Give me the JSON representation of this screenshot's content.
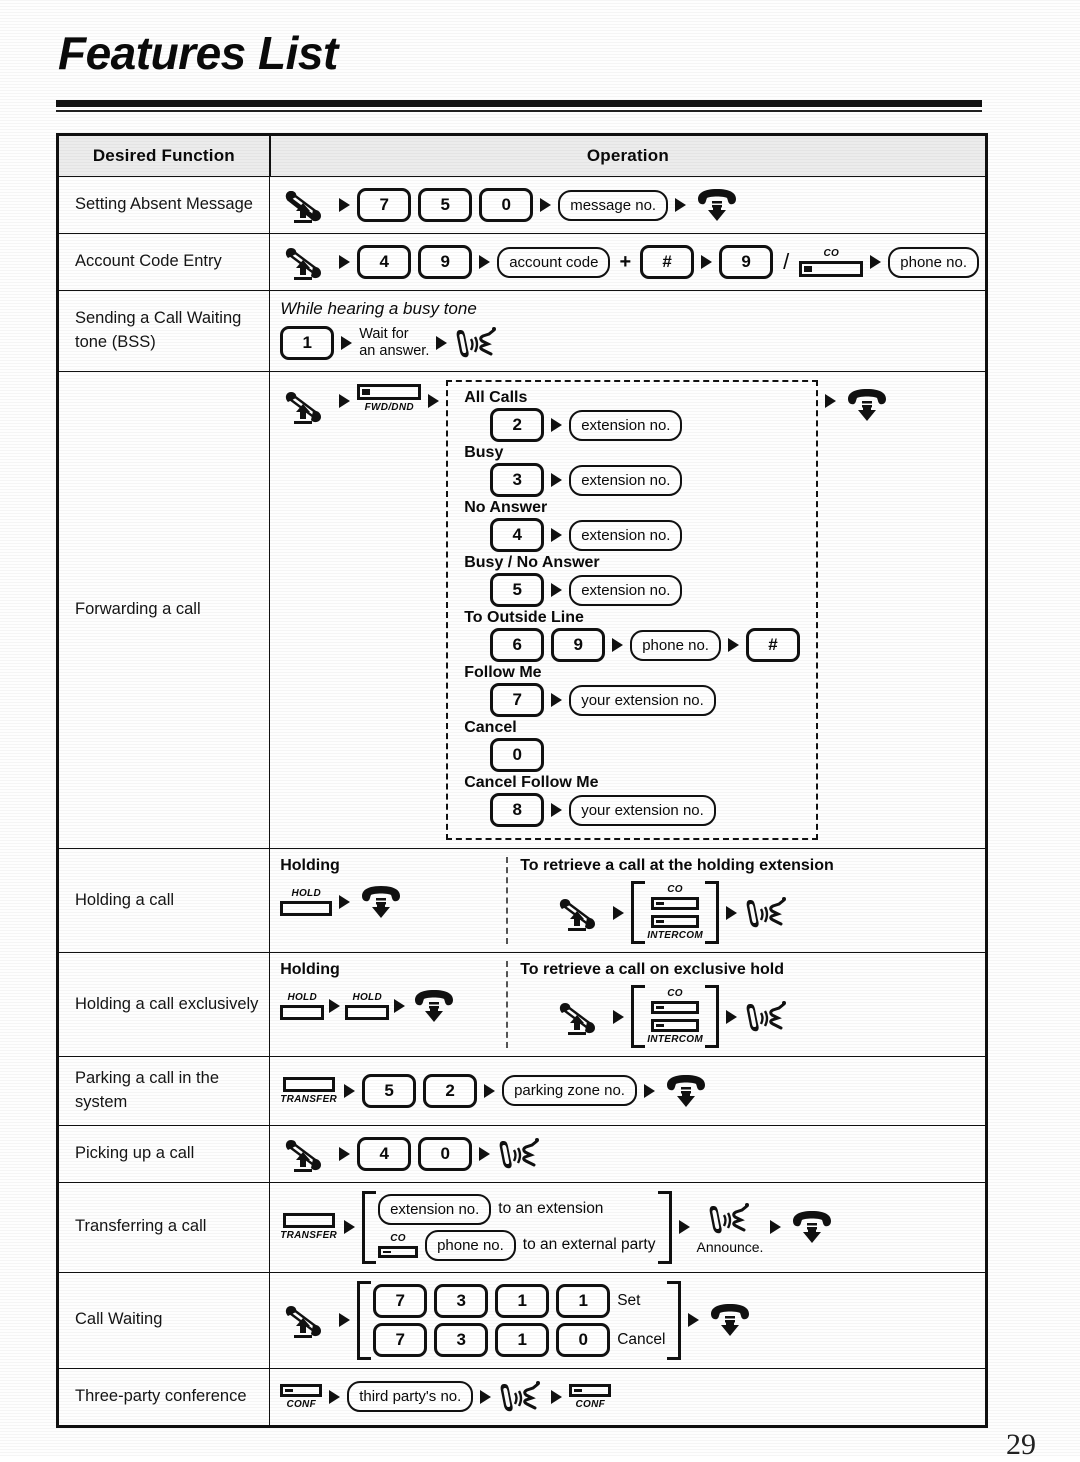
{
  "document": {
    "title": "Features List",
    "page_number": "29"
  },
  "table": {
    "headers": {
      "function": "Desired Function",
      "operation": "Operation"
    },
    "rows": [
      {
        "function": "Setting Absent Message",
        "steps": [
          "offhook-icon",
          "7",
          "5",
          "0",
          "message no.",
          "onhook-icon"
        ],
        "keys": [
          "7",
          "5",
          "0"
        ],
        "field": "message no."
      },
      {
        "function": "Account Code Entry",
        "keys": [
          "4",
          "9"
        ],
        "field_account": "account code",
        "key_hash": "#",
        "key_nine": "9",
        "co_label": "CO",
        "field_phone": "phone no."
      },
      {
        "function": "Sending a Call Waiting tone (BSS)",
        "note": "While hearing a busy tone",
        "key": "1",
        "wait_text_line1": "Wait for",
        "wait_text_line2": "an answer."
      },
      {
        "function": "Forwarding a call",
        "fwd_button_label": "FWD/DND",
        "options": [
          {
            "label": "All Calls",
            "keys": [
              "2"
            ],
            "field": "extension no."
          },
          {
            "label": "Busy",
            "keys": [
              "3"
            ],
            "field": "extension no."
          },
          {
            "label": "No Answer",
            "keys": [
              "4"
            ],
            "field": "extension no."
          },
          {
            "label": "Busy / No Answer",
            "keys": [
              "5"
            ],
            "field": "extension no."
          },
          {
            "label": "To Outside Line",
            "keys": [
              "6",
              "9"
            ],
            "field": "phone no.",
            "trailing_key": "#"
          },
          {
            "label": "Follow Me",
            "keys": [
              "7"
            ],
            "field": "your extension no."
          },
          {
            "label": "Cancel",
            "keys": [
              "0"
            ],
            "field": ""
          },
          {
            "label": "Cancel Follow Me",
            "keys": [
              "8"
            ],
            "field": "your extension no."
          }
        ]
      },
      {
        "function": "Holding a call",
        "left_head": "Holding",
        "hold_label": "HOLD",
        "right_head": "To retrieve a call at the holding extension",
        "co_label": "CO",
        "intercom_label": "INTERCOM"
      },
      {
        "function": "Holding a call exclusively",
        "left_head": "Holding",
        "hold_label": "HOLD",
        "right_head": "To retrieve a call on exclusive hold",
        "co_label": "CO",
        "intercom_label": "INTERCOM"
      },
      {
        "function": "Parking a call in the system",
        "transfer_label": "TRANSFER",
        "keys": [
          "5",
          "2"
        ],
        "field": "parking zone no."
      },
      {
        "function": "Picking up a call",
        "keys": [
          "4",
          "0"
        ]
      },
      {
        "function": "Transferring a call",
        "transfer_label": "TRANSFER",
        "opt1_field": "extension no.",
        "opt1_text": "to an extension",
        "co_label": "CO",
        "opt2_field": "phone no.",
        "opt2_text": "to an external party",
        "announce": "Announce."
      },
      {
        "function": "Call Waiting",
        "set_keys": [
          "7",
          "3",
          "1",
          "1"
        ],
        "set_label": "Set",
        "cancel_keys": [
          "7",
          "3",
          "1",
          "0"
        ],
        "cancel_label": "Cancel"
      },
      {
        "function": "Three-party conference",
        "conf_label": "CONF",
        "field": "third party's no."
      }
    ]
  },
  "icons": {
    "offhook": "offhook-handset-icon",
    "onhook": "onhook-handset-icon",
    "talk": "talk-handset-icon"
  }
}
